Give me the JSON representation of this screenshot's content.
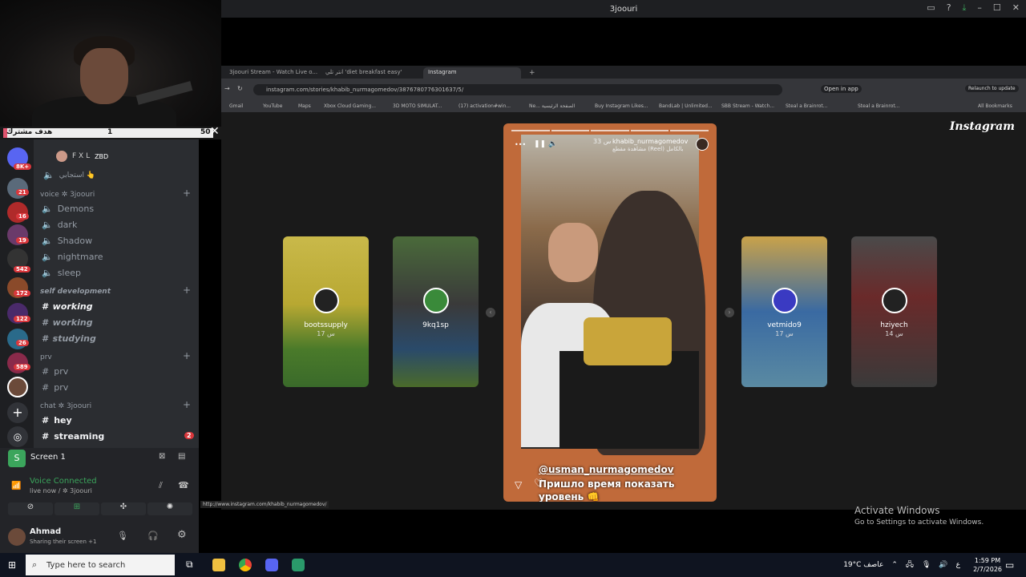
{
  "window": {
    "title": "3joouri"
  },
  "goal": {
    "label": "هدف مشترك",
    "current": "1",
    "target": "50",
    "progress_fraction": 0.02
  },
  "servers": {
    "badges": [
      "8K+",
      "21",
      "16",
      "19",
      "542",
      "172",
      "122",
      "26",
      "589"
    ]
  },
  "voice_top_user": {
    "name": "F X L",
    "tag": "ZBD",
    "status": "استجابي 👆"
  },
  "categories": {
    "voice": "voice ✲ 3joouri",
    "self_dev": "self development",
    "prv": "prv",
    "chat": "chat ✲ 3joouri"
  },
  "voice_channels": [
    "Demons",
    "dark",
    "Shadow",
    "nightmare",
    "sleep"
  ],
  "self_dev_channels": [
    "working",
    "working",
    "studying"
  ],
  "prv_channels": [
    "prv",
    "prv"
  ],
  "chat_channels": [
    "hey",
    "streaming"
  ],
  "streaming_badge": "2",
  "screen_share": {
    "label": "Screen 1"
  },
  "voice": {
    "status": "Voice Connected",
    "sub": "live now / ✲ 3joouri"
  },
  "user": {
    "name": "Ahmad",
    "status": "Sharing their screen +1"
  },
  "browser": {
    "tabs": [
      "3joouri Stream - Watch Live o...",
      "انتر تلي 'diet breakfast easy'",
      "Instagram"
    ],
    "url": "instagram.com/stories/khabib_nurmagomedov/3876780776301637/5/",
    "open_in_app": "Open in app",
    "relaunch": "Relaunch to update",
    "bookmarks": [
      "Gmail",
      "YouTube",
      "Maps",
      "Xbox Cloud Gaming...",
      "3D MOTO SIMULAT...",
      "(17) activation#win...",
      "Ne... الصفحة الرئيسية",
      "Buy Instagram Likes...",
      "BandLab | Unlimited...",
      "SBB Stream - Watch...",
      "Steal a Brainrot...",
      "Steal a Brainrot...",
      "All Bookmarks"
    ]
  },
  "instagram": {
    "logo": "Instagram",
    "story_user": "khabib_nurmagomedov",
    "story_time": "33 س",
    "story_sub": "مشاهدة مقطع (Reel) بالكامل",
    "caption_user": "@usman_nurmagomedov",
    "caption_text": "Пришло время показать уровень 👊",
    "side_cards": [
      {
        "user": "bootssupply",
        "time": "17 س"
      },
      {
        "user": "9kq1sp",
        "time": ""
      },
      {
        "user": "vetmido9",
        "time": "17 س"
      },
      {
        "user": "hziyech",
        "time": "14 س"
      }
    ]
  },
  "status_url": "http://www.instagram.com/khabib_nurmagomedov/",
  "activate": {
    "title": "Activate Windows",
    "sub": "Go to Settings to activate Windows."
  },
  "taskbar": {
    "search_placeholder": "Type here to search",
    "weather": "19°C عاصف",
    "time": "1:59 PM",
    "date": "2/7/2026",
    "lang": "ع"
  }
}
